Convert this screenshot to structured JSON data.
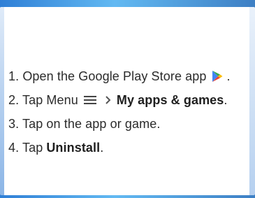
{
  "instructions": {
    "step1": {
      "prefix": "1. Open the Google Play Store app",
      "suffix": ".",
      "icon": "google-play-icon"
    },
    "step2": {
      "prefix": "2. Tap Menu",
      "menu_icon": "hamburger-menu-icon",
      "chevron_icon": "chevron-right-icon",
      "bold_text": "My apps & games",
      "suffix": "."
    },
    "step3": {
      "text": "3. Tap on the app or game."
    },
    "step4": {
      "prefix": "4. Tap",
      "bold_text": "Uninstall",
      "suffix": "."
    }
  },
  "colors": {
    "background_blue": "#3d8fe0",
    "text": "#2b2b2b",
    "play_green": "#34a853",
    "play_blue": "#4285f4",
    "play_yellow": "#fbbc04",
    "play_red": "#ea4335"
  }
}
